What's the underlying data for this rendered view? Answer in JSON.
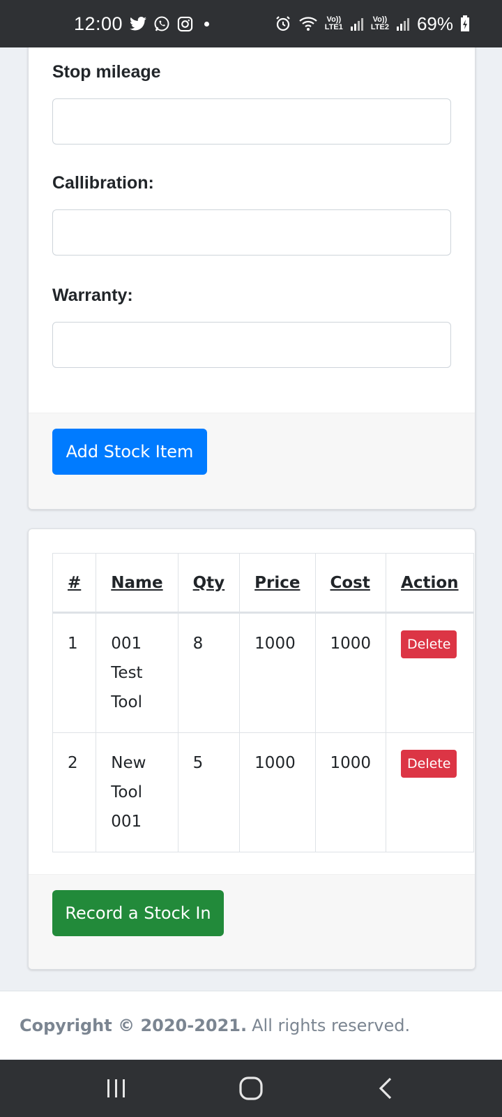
{
  "status_bar": {
    "time": "12:00",
    "battery": "69%",
    "sim1": "Vo))\nLTE1",
    "sim2": "Vo))\nLTE2",
    "icons": [
      "twitter-icon",
      "whatsapp-icon",
      "instagram-icon",
      "alarm-icon",
      "wifi-icon",
      "signal-icon",
      "battery-icon"
    ]
  },
  "form": {
    "stop_mileage_label": "Stop mileage",
    "stop_mileage_value": "",
    "callibration_label": "Callibration:",
    "callibration_value": "",
    "warranty_label": "Warranty:",
    "warranty_value": "",
    "add_button": "Add Stock Item"
  },
  "table": {
    "headers": [
      "#",
      "Name",
      "Qty",
      "Price",
      "Cost",
      "Action"
    ],
    "rows": [
      {
        "num": "1",
        "name_lines": [
          "001",
          "Test",
          "Tool"
        ],
        "qty": "8",
        "price": "1000",
        "cost": "1000",
        "action": "Delete"
      },
      {
        "num": "2",
        "name_lines": [
          "New",
          "Tool",
          "001"
        ],
        "qty": "5",
        "price": "1000",
        "cost": "1000",
        "action": "Delete"
      }
    ],
    "record_button": "Record a Stock In"
  },
  "footer": {
    "copyright_bold": "Copyright © 2020-2021.",
    "rights": "All rights reserved."
  },
  "colors": {
    "primary": "#007bff",
    "success": "#228a3a",
    "danger": "#dc3545",
    "system_bar": "#2f3134"
  }
}
